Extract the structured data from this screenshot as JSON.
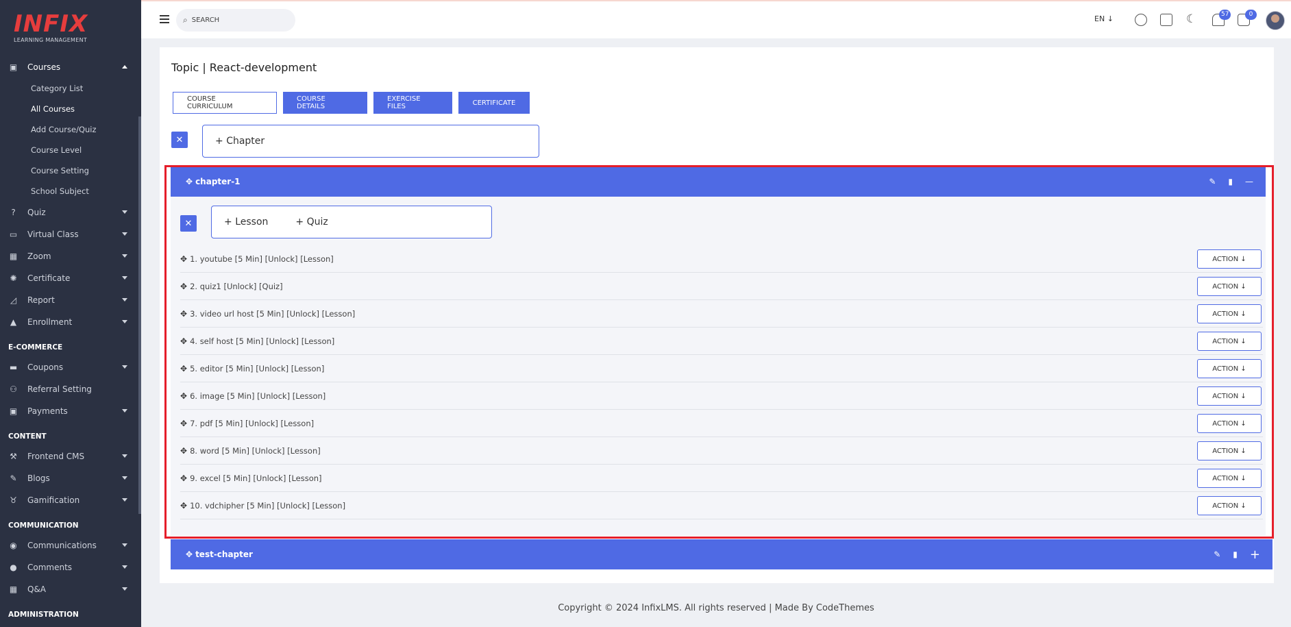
{
  "logo": {
    "text": "INFIX",
    "subtitle": "LEARNING MANAGEMENT"
  },
  "sidebar": {
    "courses": {
      "label": "Courses",
      "items": [
        "Category List",
        "All Courses",
        "Add Course/Quiz",
        "Course Level",
        "Course Setting",
        "School Subject"
      ]
    },
    "items1": [
      {
        "label": "Quiz",
        "icon": "question-icon"
      },
      {
        "label": "Virtual Class",
        "icon": "vr-icon"
      },
      {
        "label": "Zoom",
        "icon": "grid-icon"
      },
      {
        "label": "Certificate",
        "icon": "badge-icon"
      },
      {
        "label": "Report",
        "icon": "chart-icon"
      },
      {
        "label": "Enrollment",
        "icon": "enroll-icon"
      }
    ],
    "ecommerce_heading": "E-COMMERCE",
    "items2": [
      {
        "label": "Coupons",
        "icon": "coupon-icon"
      },
      {
        "label": "Referral Setting",
        "icon": "referral-icon"
      },
      {
        "label": "Payments",
        "icon": "payment-icon"
      }
    ],
    "content_heading": "CONTENT",
    "items3": [
      {
        "label": "Frontend CMS",
        "icon": "brush-icon"
      },
      {
        "label": "Blogs",
        "icon": "edit-icon"
      },
      {
        "label": "Gamification",
        "icon": "medal-icon"
      }
    ],
    "communication_heading": "COMMUNICATION",
    "items4": [
      {
        "label": "Communications",
        "icon": "chat-icon"
      },
      {
        "label": "Comments",
        "icon": "comment-icon"
      },
      {
        "label": "Q&A",
        "icon": "qa-icon"
      }
    ],
    "administration_heading": "ADMINISTRATION"
  },
  "topbar": {
    "search_placeholder": "SEARCH",
    "lang": "EN",
    "notifications_count": "57",
    "messages_count": "0"
  },
  "page": {
    "title": "Topic | React-development",
    "tabs": [
      "COURSE CURRICULUM",
      "COURSE DETAILS",
      "EXERCISE FILES",
      "CERTIFICATE"
    ],
    "add_chapter": "Chapter",
    "chapter1": "chapter-1",
    "add_lesson": "Lesson",
    "add_quiz": "Quiz",
    "lessons": [
      "1. youtube [5 Min] [Unlock] [Lesson]",
      "2. quiz1 [Unlock] [Quiz]",
      "3. video url host [5 Min] [Unlock] [Lesson]",
      "4. self host [5 Min] [Unlock] [Lesson]",
      "5. editor [5 Min] [Unlock] [Lesson]",
      "6. image [5 Min] [Unlock] [Lesson]",
      "7. pdf [5 Min] [Unlock] [Lesson]",
      "8. word [5 Min] [Unlock] [Lesson]",
      "9. excel [5 Min] [Unlock] [Lesson]",
      "10. vdchipher [5 Min] [Unlock] [Lesson]"
    ],
    "action_label": "ACTION",
    "chapter2": "test-chapter"
  },
  "footer": "Copyright © 2024 InfixLMS. All rights reserved | Made By CodeThemes",
  "colors": {
    "accent": "#4f6ae4",
    "sidebar": "#2b3142",
    "highlight": "#e51e2a"
  }
}
